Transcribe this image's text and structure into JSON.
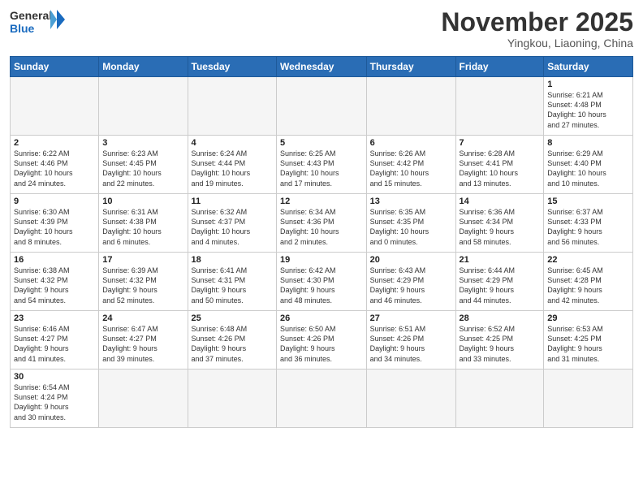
{
  "header": {
    "logo_general": "General",
    "logo_blue": "Blue",
    "month_title": "November 2025",
    "location": "Yingkou, Liaoning, China"
  },
  "weekdays": [
    "Sunday",
    "Monday",
    "Tuesday",
    "Wednesday",
    "Thursday",
    "Friday",
    "Saturday"
  ],
  "weeks": [
    [
      {
        "day": "",
        "info": ""
      },
      {
        "day": "",
        "info": ""
      },
      {
        "day": "",
        "info": ""
      },
      {
        "day": "",
        "info": ""
      },
      {
        "day": "",
        "info": ""
      },
      {
        "day": "",
        "info": ""
      },
      {
        "day": "1",
        "info": "Sunrise: 6:21 AM\nSunset: 4:48 PM\nDaylight: 10 hours\nand 27 minutes."
      }
    ],
    [
      {
        "day": "2",
        "info": "Sunrise: 6:22 AM\nSunset: 4:46 PM\nDaylight: 10 hours\nand 24 minutes."
      },
      {
        "day": "3",
        "info": "Sunrise: 6:23 AM\nSunset: 4:45 PM\nDaylight: 10 hours\nand 22 minutes."
      },
      {
        "day": "4",
        "info": "Sunrise: 6:24 AM\nSunset: 4:44 PM\nDaylight: 10 hours\nand 19 minutes."
      },
      {
        "day": "5",
        "info": "Sunrise: 6:25 AM\nSunset: 4:43 PM\nDaylight: 10 hours\nand 17 minutes."
      },
      {
        "day": "6",
        "info": "Sunrise: 6:26 AM\nSunset: 4:42 PM\nDaylight: 10 hours\nand 15 minutes."
      },
      {
        "day": "7",
        "info": "Sunrise: 6:28 AM\nSunset: 4:41 PM\nDaylight: 10 hours\nand 13 minutes."
      },
      {
        "day": "8",
        "info": "Sunrise: 6:29 AM\nSunset: 4:40 PM\nDaylight: 10 hours\nand 10 minutes."
      }
    ],
    [
      {
        "day": "9",
        "info": "Sunrise: 6:30 AM\nSunset: 4:39 PM\nDaylight: 10 hours\nand 8 minutes."
      },
      {
        "day": "10",
        "info": "Sunrise: 6:31 AM\nSunset: 4:38 PM\nDaylight: 10 hours\nand 6 minutes."
      },
      {
        "day": "11",
        "info": "Sunrise: 6:32 AM\nSunset: 4:37 PM\nDaylight: 10 hours\nand 4 minutes."
      },
      {
        "day": "12",
        "info": "Sunrise: 6:34 AM\nSunset: 4:36 PM\nDaylight: 10 hours\nand 2 minutes."
      },
      {
        "day": "13",
        "info": "Sunrise: 6:35 AM\nSunset: 4:35 PM\nDaylight: 10 hours\nand 0 minutes."
      },
      {
        "day": "14",
        "info": "Sunrise: 6:36 AM\nSunset: 4:34 PM\nDaylight: 9 hours\nand 58 minutes."
      },
      {
        "day": "15",
        "info": "Sunrise: 6:37 AM\nSunset: 4:33 PM\nDaylight: 9 hours\nand 56 minutes."
      }
    ],
    [
      {
        "day": "16",
        "info": "Sunrise: 6:38 AM\nSunset: 4:32 PM\nDaylight: 9 hours\nand 54 minutes."
      },
      {
        "day": "17",
        "info": "Sunrise: 6:39 AM\nSunset: 4:32 PM\nDaylight: 9 hours\nand 52 minutes."
      },
      {
        "day": "18",
        "info": "Sunrise: 6:41 AM\nSunset: 4:31 PM\nDaylight: 9 hours\nand 50 minutes."
      },
      {
        "day": "19",
        "info": "Sunrise: 6:42 AM\nSunset: 4:30 PM\nDaylight: 9 hours\nand 48 minutes."
      },
      {
        "day": "20",
        "info": "Sunrise: 6:43 AM\nSunset: 4:29 PM\nDaylight: 9 hours\nand 46 minutes."
      },
      {
        "day": "21",
        "info": "Sunrise: 6:44 AM\nSunset: 4:29 PM\nDaylight: 9 hours\nand 44 minutes."
      },
      {
        "day": "22",
        "info": "Sunrise: 6:45 AM\nSunset: 4:28 PM\nDaylight: 9 hours\nand 42 minutes."
      }
    ],
    [
      {
        "day": "23",
        "info": "Sunrise: 6:46 AM\nSunset: 4:27 PM\nDaylight: 9 hours\nand 41 minutes."
      },
      {
        "day": "24",
        "info": "Sunrise: 6:47 AM\nSunset: 4:27 PM\nDaylight: 9 hours\nand 39 minutes."
      },
      {
        "day": "25",
        "info": "Sunrise: 6:48 AM\nSunset: 4:26 PM\nDaylight: 9 hours\nand 37 minutes."
      },
      {
        "day": "26",
        "info": "Sunrise: 6:50 AM\nSunset: 4:26 PM\nDaylight: 9 hours\nand 36 minutes."
      },
      {
        "day": "27",
        "info": "Sunrise: 6:51 AM\nSunset: 4:26 PM\nDaylight: 9 hours\nand 34 minutes."
      },
      {
        "day": "28",
        "info": "Sunrise: 6:52 AM\nSunset: 4:25 PM\nDaylight: 9 hours\nand 33 minutes."
      },
      {
        "day": "29",
        "info": "Sunrise: 6:53 AM\nSunset: 4:25 PM\nDaylight: 9 hours\nand 31 minutes."
      }
    ],
    [
      {
        "day": "30",
        "info": "Sunrise: 6:54 AM\nSunset: 4:24 PM\nDaylight: 9 hours\nand 30 minutes."
      },
      {
        "day": "",
        "info": ""
      },
      {
        "day": "",
        "info": ""
      },
      {
        "day": "",
        "info": ""
      },
      {
        "day": "",
        "info": ""
      },
      {
        "day": "",
        "info": ""
      },
      {
        "day": "",
        "info": ""
      }
    ]
  ]
}
